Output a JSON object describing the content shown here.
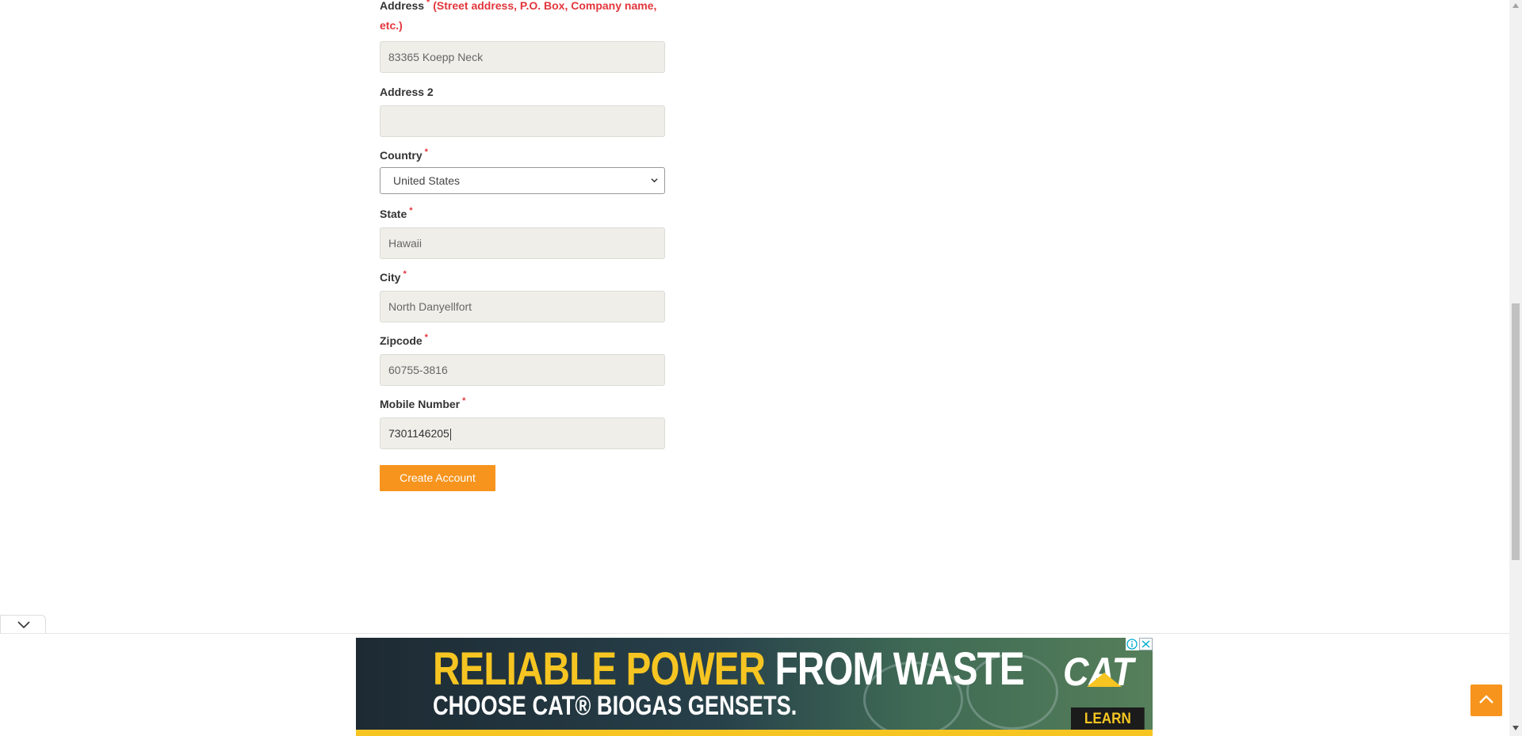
{
  "form": {
    "address_label": "Address",
    "address_hint": "(Street address, P.O. Box, Company name, etc.)",
    "address_value": "83365 Koepp Neck",
    "address2_label": "Address 2",
    "address2_value": "",
    "country_label": "Country",
    "country_value": "United States",
    "state_label": "State",
    "state_value": "Hawaii",
    "city_label": "City",
    "city_value": "North Danyellfort",
    "zipcode_label": "Zipcode",
    "zipcode_value": "60755-3816",
    "mobile_label": "Mobile Number",
    "mobile_value": "7301146205",
    "required_mark": "*",
    "submit_label": "Create Account"
  },
  "ad": {
    "line1_yellow": "RELIABLE POWER",
    "line1_white": "FROM WASTE",
    "line2": "CHOOSE CAT® BIOGAS GENSETS.",
    "logo": "CAT",
    "cta": "LEARN MORE",
    "icons": [
      "ad-info-icon",
      "ad-close-icon"
    ]
  },
  "icons": {
    "collapse": "chevron-down-icon",
    "back_to_top": "chevron-up-icon"
  },
  "colors": {
    "accent": "#f7941d",
    "required": "#e2363c",
    "input_bg": "#efeee9"
  }
}
